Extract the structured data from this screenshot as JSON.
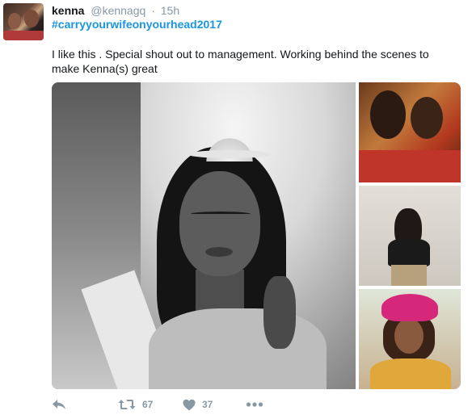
{
  "tweet": {
    "author": {
      "name": "kenna",
      "handle": "@kennagq",
      "separator": "·",
      "time": "15h"
    },
    "hashtag": "#carryyourwifeonyourhead2017",
    "text": "I like this . Special shout out to management.  Working behind the scenes to make Kenna(s) great",
    "media": {
      "count": 4
    },
    "actions": {
      "reply": {
        "icon": "reply-icon"
      },
      "retweet": {
        "icon": "retweet-icon",
        "count": "67"
      },
      "like": {
        "icon": "heart-icon",
        "count": "37"
      },
      "more": {
        "icon": "more-dots-icon"
      }
    }
  },
  "colors": {
    "link": "#1b95e0",
    "muted": "#8899a6",
    "text": "#14171a"
  }
}
